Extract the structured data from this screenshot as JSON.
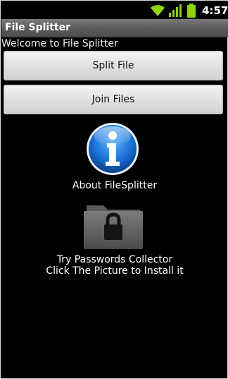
{
  "status_bar": {
    "time": "4:57",
    "icons": [
      "wifi-icon",
      "signal-icon",
      "battery-icon"
    ],
    "icon_color": "#8fd400"
  },
  "app": {
    "title": "File Splitter",
    "welcome": "Welcome to File Splitter"
  },
  "buttons": {
    "split_label": "Split File",
    "join_label": "Join Files"
  },
  "about": {
    "icon": "info-icon",
    "label": "About FileSplitter"
  },
  "promo": {
    "icon": "locked-folder-icon",
    "line1": "Try Passwords Collector",
    "line2": "Click The Picture to Install it"
  },
  "colors": {
    "background": "#000000",
    "accent_blue": "#1a73d9"
  }
}
